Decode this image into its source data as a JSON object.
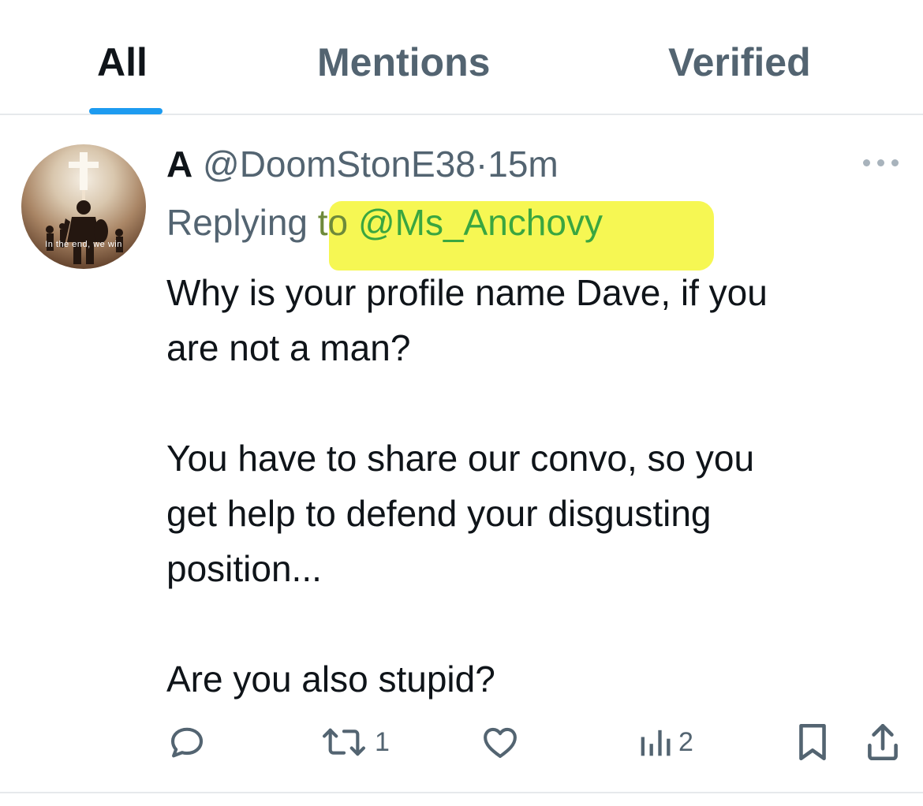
{
  "tabs": [
    {
      "label": "All",
      "active": true
    },
    {
      "label": "Mentions",
      "active": false
    },
    {
      "label": "Verified",
      "active": false
    }
  ],
  "colors": {
    "accent": "#1d9bf0",
    "text_primary": "#0f1419",
    "text_secondary": "#536471",
    "highlight": "#f6f74a"
  },
  "tweet": {
    "avatar": {
      "icon": "knight-cross-avatar",
      "caption": "In the end, we win"
    },
    "author_name": "A",
    "handle": "@DoomStonE38",
    "separator": "·",
    "time": "15m",
    "more_icon": "more-icon",
    "replying_prefix": "Replying",
    "replying_to": "to",
    "replying_handle": "@Ms_Anchovy",
    "body": [
      "Why is your profile name Dave, if you\nare not a man?",
      "You have to share our convo, so you\nget help to defend your disgusting\nposition...",
      "Are you also stupid?"
    ],
    "actions": {
      "reply": {
        "icon": "reply-icon",
        "count": ""
      },
      "retweet": {
        "icon": "retweet-icon",
        "count": "1"
      },
      "like": {
        "icon": "heart-icon",
        "count": ""
      },
      "views": {
        "icon": "views-icon",
        "count": "2"
      },
      "bookmark": {
        "icon": "bookmark-icon"
      },
      "share": {
        "icon": "share-icon"
      }
    }
  }
}
